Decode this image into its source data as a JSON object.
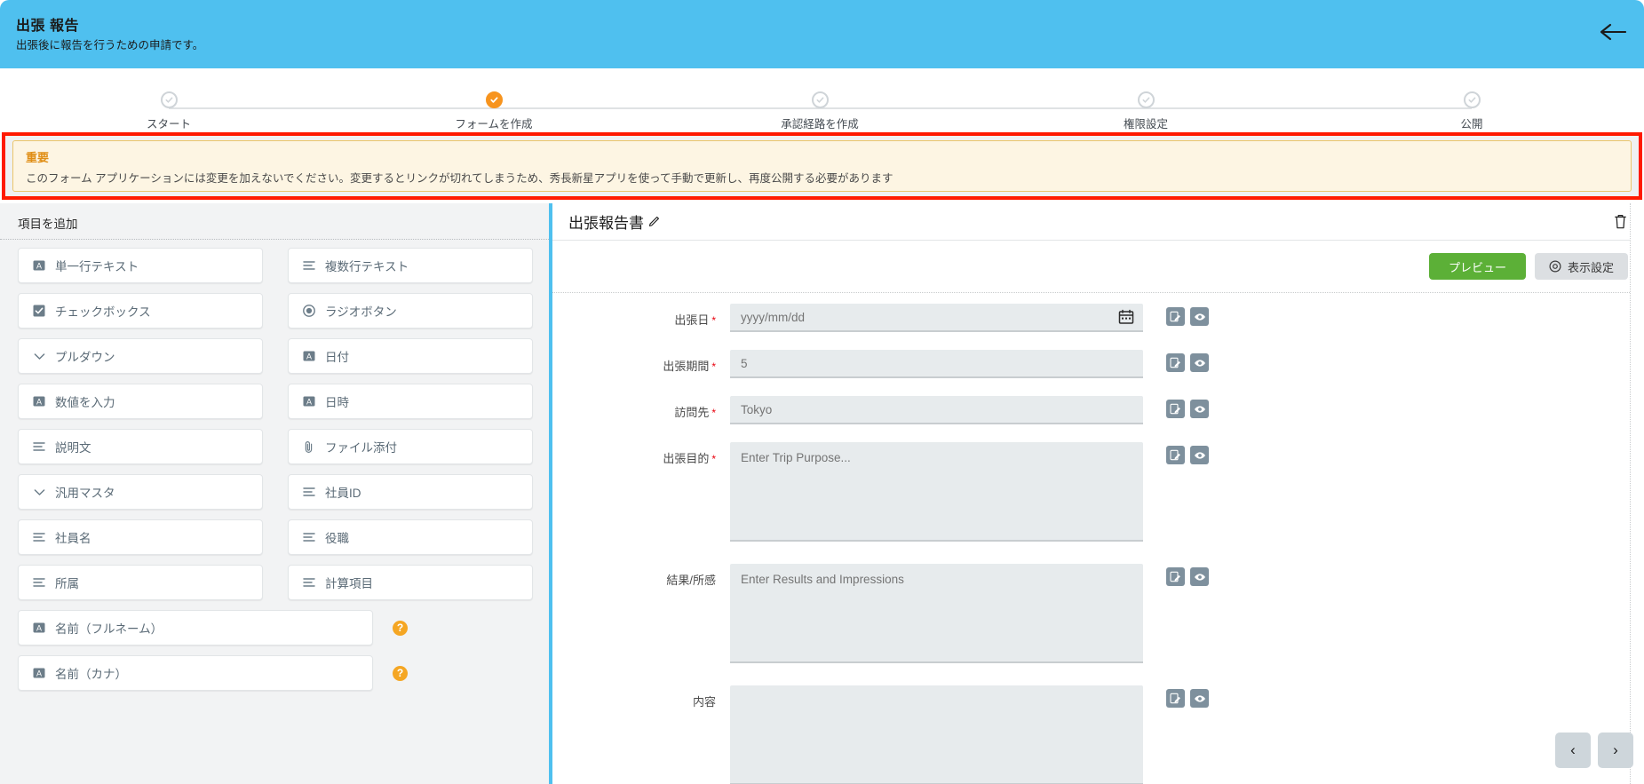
{
  "header": {
    "title": "出張 報告",
    "subtitle": "出張後に報告を行うための申請です。",
    "back_icon": "arrow-left-icon"
  },
  "stepper": {
    "steps": [
      {
        "label": "スタート",
        "state": "inactive"
      },
      {
        "label": "フォームを作成",
        "state": "active"
      },
      {
        "label": "承認経路を作成",
        "state": "inactive"
      },
      {
        "label": "権限設定",
        "state": "inactive"
      },
      {
        "label": "公開",
        "state": "inactive"
      }
    ],
    "active_color": "#f7941e",
    "inactive_color": "#cfd4d8"
  },
  "alert": {
    "title": "重要",
    "message": "このフォーム アプリケーションには変更を加えないでください。変更するとリンクが切れてしまうため、秀長新星アプリを使って手動で更新し、再度公開する必要があります",
    "outline_color": "#ff1a00",
    "background_color": "#fdf5e3",
    "title_color": "#e08e15"
  },
  "palette": {
    "title": "項目を追加",
    "items": [
      {
        "label": "単一行テキスト",
        "icon": "text-box-icon"
      },
      {
        "label": "複数行テキスト",
        "icon": "lines-icon"
      },
      {
        "label": "チェックボックス",
        "icon": "checkbox-icon"
      },
      {
        "label": "ラジオボタン",
        "icon": "radio-icon"
      },
      {
        "label": "プルダウン",
        "icon": "chevron-down-icon"
      },
      {
        "label": "日付",
        "icon": "text-box-icon"
      },
      {
        "label": "数値を入力",
        "icon": "text-box-icon"
      },
      {
        "label": "日時",
        "icon": "text-box-icon"
      },
      {
        "label": "説明文",
        "icon": "lines-icon"
      },
      {
        "label": "ファイル添付",
        "icon": "paperclip-icon"
      },
      {
        "label": "汎用マスタ",
        "icon": "chevron-down-icon"
      },
      {
        "label": "社員ID",
        "icon": "lines-icon"
      },
      {
        "label": "社員名",
        "icon": "lines-icon"
      },
      {
        "label": "役職",
        "icon": "lines-icon"
      },
      {
        "label": "所属",
        "icon": "lines-icon"
      },
      {
        "label": "計算項目",
        "icon": "lines-icon"
      }
    ],
    "wide_items": [
      {
        "label": "名前（フルネーム）",
        "icon": "text-box-icon",
        "help": "?"
      },
      {
        "label": "名前（カナ）",
        "icon": "text-box-icon",
        "help": "?"
      }
    ]
  },
  "canvas": {
    "title": "出張報告書",
    "edit_icon": "pencil-icon",
    "delete_icon": "trash-icon",
    "toolbar": {
      "preview_label": "プレビュー",
      "preview_color": "#5cb037",
      "display_settings_label": "表示設定",
      "display_settings_icon": "eye-gear-icon"
    },
    "fields": [
      {
        "label": "出張日",
        "required": true,
        "type": "date",
        "placeholder": "yyyy/mm/dd",
        "value": "",
        "trailing_icon": "calendar-icon",
        "actions": [
          "edit-icon",
          "eye-icon"
        ]
      },
      {
        "label": "出張期間",
        "required": true,
        "type": "text",
        "placeholder": "5",
        "value": "",
        "actions": [
          "edit-icon",
          "eye-icon"
        ]
      },
      {
        "label": "訪問先",
        "required": true,
        "type": "text",
        "placeholder": "Tokyo",
        "value": "",
        "actions": [
          "edit-icon",
          "eye-icon"
        ]
      },
      {
        "label": "出張目的",
        "required": true,
        "type": "textarea",
        "placeholder": "Enter Trip Purpose...",
        "value": "",
        "actions": [
          "edit-icon",
          "eye-icon"
        ]
      },
      {
        "label": "結果/所感",
        "required": false,
        "type": "textarea",
        "placeholder": "Enter Results and Impressions",
        "value": "",
        "actions": [
          "edit-icon",
          "eye-icon"
        ]
      },
      {
        "label": "内容",
        "required": false,
        "type": "textarea",
        "placeholder": "",
        "value": "",
        "actions": [
          "edit-icon",
          "eye-icon"
        ]
      }
    ],
    "pager": {
      "prev_label": "‹",
      "next_label": "›"
    }
  }
}
